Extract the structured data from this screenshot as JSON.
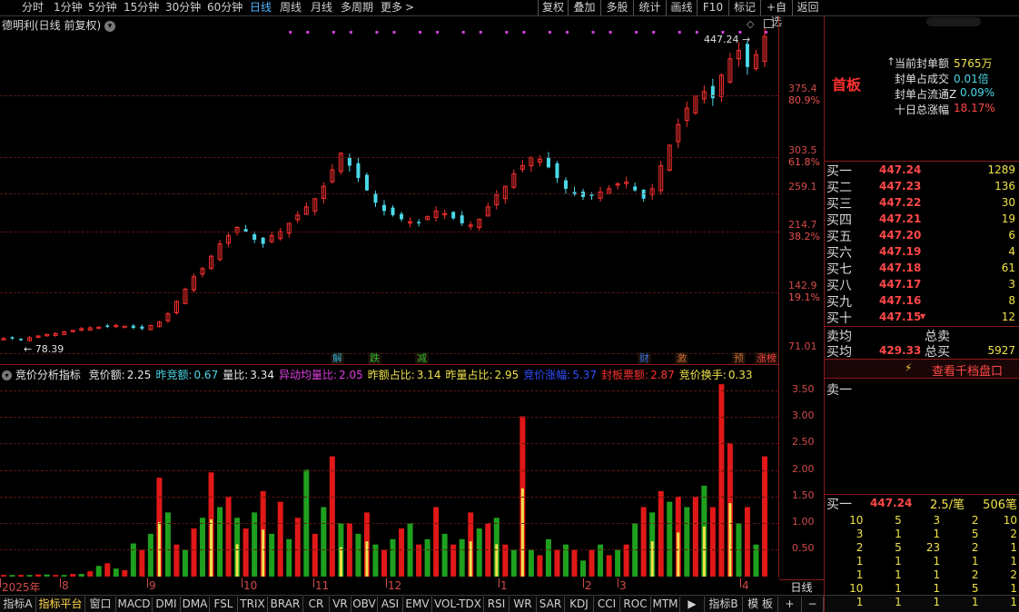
{
  "toolbar": {
    "periods": [
      {
        "label": "分时",
        "active": false
      },
      {
        "label": "1分钟",
        "active": false
      },
      {
        "label": "5分钟",
        "active": false
      },
      {
        "label": "15分钟",
        "active": false
      },
      {
        "label": "30分钟",
        "active": false
      },
      {
        "label": "60分钟",
        "active": false
      },
      {
        "label": "日线",
        "active": true
      },
      {
        "label": "周线",
        "active": false
      },
      {
        "label": "月线",
        "active": false
      },
      {
        "label": "多周期",
        "active": false
      },
      {
        "label": "更多",
        "active": false
      }
    ],
    "more_arrow": ">",
    "right_buttons": [
      "复权",
      "叠加",
      "多股",
      "统计",
      "画线",
      "F10",
      "标记",
      "+自选",
      "返回"
    ]
  },
  "chart": {
    "title": "德明利(日线 前复权)",
    "high_label": "447.24",
    "low_label": "78.39",
    "price_axis": [
      {
        "value": "375.4",
        "pct": "80.9%"
      },
      {
        "value": "303.5",
        "pct": "61.8%"
      },
      {
        "value": "259.1",
        "pct": ""
      },
      {
        "value": "214.7",
        "pct": "38.2%"
      },
      {
        "value": "142.9",
        "pct": "19.1%"
      },
      {
        "value": "71.01",
        "pct": ""
      }
    ],
    "event_markers": [
      {
        "label": "解",
        "color": "#2fa8c8"
      },
      {
        "label": "跌",
        "color": "#2fb82f"
      },
      {
        "label": "减",
        "color": "#2fb82f"
      },
      {
        "label": "财",
        "color": "#2f6fe0"
      },
      {
        "label": "激",
        "color": "#c86a2f"
      },
      {
        "label": "预",
        "color": "#c86a2f"
      },
      {
        "label": "涨榜",
        "color": "#ff4040"
      }
    ]
  },
  "indicator": {
    "name": "竞价分析指标",
    "values": [
      {
        "label": "竞价额:",
        "value": "2.25",
        "color": "#e8e8e8"
      },
      {
        "label": "昨竞额:",
        "value": "0.67",
        "color": "#4ad8e8"
      },
      {
        "label": "量比:",
        "value": "3.34",
        "color": "#e8e8e8"
      },
      {
        "label": "异动均量比:",
        "value": "2.05",
        "color": "#e040e0"
      },
      {
        "label": "昨额占比:",
        "value": "3.14",
        "color": "#f0e24a"
      },
      {
        "label": "昨量占比:",
        "value": "2.95",
        "color": "#f0e24a"
      },
      {
        "label": "竞价涨幅:",
        "value": "5.37",
        "color": "#3050ff"
      },
      {
        "label": "封板票额:",
        "value": "2.87",
        "color": "#ff3030"
      },
      {
        "label": "竞价换手:",
        "value": "0.33",
        "color": "#f0e24a"
      }
    ],
    "axis": [
      "3.50",
      "3.00",
      "2.50",
      "2.00",
      "1.50",
      "1.00",
      "0.50"
    ]
  },
  "time_axis": {
    "labels": [
      "2025年",
      "8",
      "9",
      "10",
      "11",
      "12",
      "1",
      "2",
      "3",
      "4"
    ],
    "period_box": "日线"
  },
  "bottom_tabs": [
    "指标A",
    "指标平台",
    "窗口",
    "MACD",
    "DMI",
    "DMA",
    "FSL",
    "TRIX",
    "BRAR",
    "CR",
    "VR",
    "OBV",
    "ASI",
    "EMV",
    "VOL-TDX",
    "RSI",
    "WR",
    "SAR",
    "KDJ",
    "CCI",
    "ROC",
    "MTM",
    "▶",
    "指标B",
    "模 板",
    "+",
    "−"
  ],
  "panel": {
    "board_type": "首板",
    "stats": [
      {
        "label": "当前封单额",
        "value": "5765万"
      },
      {
        "label": "封单占成交",
        "value": "0.01倍"
      },
      {
        "label": "封单占流通Z",
        "value": "0.09%"
      },
      {
        "label": "十日总涨幅",
        "value": "18.17%"
      }
    ],
    "bids": [
      {
        "label": "买一",
        "price": "447.24",
        "vol": "1289"
      },
      {
        "label": "买二",
        "price": "447.23",
        "vol": "136"
      },
      {
        "label": "买三",
        "price": "447.22",
        "vol": "30"
      },
      {
        "label": "买四",
        "price": "447.21",
        "vol": "19"
      },
      {
        "label": "买五",
        "price": "447.20",
        "vol": "6"
      },
      {
        "label": "买六",
        "price": "447.19",
        "vol": "4"
      },
      {
        "label": "买七",
        "price": "447.18",
        "vol": "61"
      },
      {
        "label": "买八",
        "price": "447.17",
        "vol": "3"
      },
      {
        "label": "买九",
        "price": "447.16",
        "vol": "8"
      },
      {
        "label": "买十",
        "price": "447.15",
        "vol": "12"
      }
    ],
    "sell_avg_label": "卖均",
    "total_sell_label": "总卖",
    "buy_avg_label": "买均",
    "buy_avg": "429.33",
    "total_buy_label": "总买",
    "total_buy": "5927",
    "qiandang_button": "查看千档盘口",
    "sell1_label": "卖一",
    "buy1_label": "买一",
    "buy1_price": "447.24",
    "buy1_rate": "2.5/笔",
    "buy1_count": "506笔",
    "detail_grid": [
      [
        "10",
        "5",
        "3",
        "2",
        "10"
      ],
      [
        "3",
        "1",
        "1",
        "5",
        "2"
      ],
      [
        "2",
        "5",
        "23",
        "2",
        "1"
      ],
      [
        "1",
        "1",
        "1",
        "1",
        "1"
      ],
      [
        "1",
        "1",
        "1",
        "2",
        "2"
      ],
      [
        "10",
        "1",
        "1",
        "5",
        "1"
      ],
      [
        "1",
        "1",
        "1",
        "1",
        "1"
      ]
    ]
  },
  "colors": {
    "up": "#ff3030",
    "down": "#4ad8e8",
    "grid": "#5a1414",
    "accent": "#4fb7ff",
    "vol_red": "#e01818",
    "vol_green": "#1ea01e",
    "vol_yellow": "#f0e24a"
  },
  "chart_data": {
    "type": "candlestick",
    "price_axis_ticks": [
      375.4,
      303.5,
      259.1,
      214.7,
      142.9,
      71.01
    ],
    "price_high": 447.24,
    "price_low": 78.39,
    "indicator_ticks": [
      3.5,
      3.0,
      2.5,
      2.0,
      1.5,
      1.0,
      0.5
    ],
    "close_path": [
      80,
      80,
      79,
      81,
      83,
      85,
      86,
      88,
      90,
      92,
      93,
      94,
      95,
      96,
      95,
      93,
      92,
      96,
      100,
      110,
      125,
      140,
      155,
      165,
      180,
      195,
      205,
      215,
      210,
      200,
      195,
      205,
      210,
      220,
      230,
      240,
      250,
      265,
      285,
      305,
      290,
      275,
      260,
      245,
      235,
      230,
      225,
      222,
      220,
      228,
      235,
      232,
      226,
      220,
      218,
      225,
      240,
      255,
      265,
      280,
      290,
      300,
      298,
      288,
      275,
      262,
      255,
      252,
      255,
      258,
      262,
      268,
      270,
      260,
      250,
      262,
      290,
      315,
      340,
      360,
      375,
      380,
      372,
      400,
      420,
      430,
      410,
      425,
      447
    ],
    "volume_heights": [
      0.03,
      0.03,
      0.03,
      0.03,
      0.04,
      0.04,
      0.03,
      0.03,
      0.05,
      0.05,
      0.1,
      0.2,
      0.25,
      0.15,
      0.12,
      0.62,
      0.5,
      0.8,
      1.85,
      1.2,
      0.6,
      0.5,
      0.9,
      1.1,
      1.95,
      1.3,
      1.5,
      1.1,
      0.9,
      1.2,
      1.6,
      0.8,
      1.4,
      0.7,
      1.1,
      2.0,
      0.8,
      1.3,
      2.25,
      1.0,
      1.0,
      0.8,
      1.2,
      0.6,
      0.5,
      0.7,
      0.9,
      1.0,
      0.6,
      0.7,
      1.3,
      0.8,
      0.6,
      0.7,
      1.2,
      0.9,
      1.0,
      1.1,
      0.6,
      0.5,
      3.0,
      0.5,
      0.4,
      0.7,
      0.5,
      0.6,
      0.5,
      0.3,
      0.5,
      0.6,
      0.4,
      0.5,
      0.6,
      1.0,
      1.3,
      1.2,
      1.6,
      1.4,
      1.5,
      1.3,
      1.5,
      1.7,
      1.3,
      3.6,
      2.5,
      1.0,
      1.3,
      0.6,
      2.25
    ],
    "volume_colors": [
      "r",
      "g",
      "r",
      "g",
      "r",
      "g",
      "r",
      "g",
      "r",
      "g",
      "r",
      "g",
      "r",
      "g",
      "r",
      "g",
      "r",
      "g",
      "r",
      "g",
      "r",
      "g",
      "r",
      "g",
      "r",
      "g",
      "r",
      "g",
      "r",
      "g",
      "r",
      "g",
      "r",
      "g",
      "r",
      "g",
      "r",
      "g",
      "r",
      "g",
      "r",
      "g",
      "r",
      "g",
      "r",
      "g",
      "r",
      "g",
      "r",
      "g",
      "r",
      "g",
      "r",
      "g",
      "r",
      "g",
      "r",
      "g",
      "r",
      "g",
      "r",
      "g",
      "r",
      "g",
      "r",
      "g",
      "r",
      "g",
      "r",
      "g",
      "r",
      "g",
      "r",
      "g",
      "r",
      "g",
      "r",
      "g",
      "r",
      "g",
      "r",
      "g",
      "r",
      "r",
      "r",
      "g",
      "r",
      "g",
      "r"
    ]
  }
}
